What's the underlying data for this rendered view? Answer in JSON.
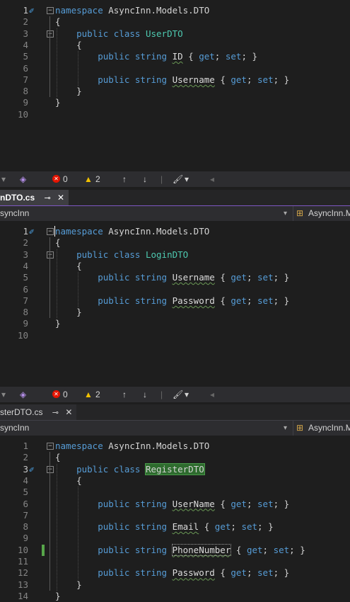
{
  "panes": [
    {
      "lines": [
        {
          "n": "1",
          "segs": [
            {
              "t": "namespace",
              "c": "kw"
            },
            {
              "t": " AsyncInn.Models.DTO",
              "c": "pl"
            }
          ]
        },
        {
          "n": "2",
          "segs": [
            {
              "t": "{",
              "c": "pl"
            }
          ]
        },
        {
          "n": "3",
          "segs": [
            {
              "t": "    public",
              "c": "kw"
            },
            {
              "t": " ",
              "c": "pl"
            },
            {
              "t": "class",
              "c": "kw"
            },
            {
              "t": " ",
              "c": "pl"
            },
            {
              "t": "UserDTO",
              "c": "ty"
            }
          ]
        },
        {
          "n": "4",
          "segs": [
            {
              "t": "    {",
              "c": "pl"
            }
          ]
        },
        {
          "n": "5",
          "segs": [
            {
              "t": "        public",
              "c": "kw"
            },
            {
              "t": " ",
              "c": "pl"
            },
            {
              "t": "string",
              "c": "kw"
            },
            {
              "t": " ",
              "c": "pl"
            },
            {
              "t": "ID",
              "c": "pr squig"
            },
            {
              "t": " { ",
              "c": "pl"
            },
            {
              "t": "get",
              "c": "kw"
            },
            {
              "t": "; ",
              "c": "pl"
            },
            {
              "t": "set",
              "c": "kw"
            },
            {
              "t": "; }",
              "c": "pl"
            }
          ]
        },
        {
          "n": "6",
          "segs": []
        },
        {
          "n": "7",
          "segs": [
            {
              "t": "        public",
              "c": "kw"
            },
            {
              "t": " ",
              "c": "pl"
            },
            {
              "t": "string",
              "c": "kw"
            },
            {
              "t": " ",
              "c": "pl"
            },
            {
              "t": "Username",
              "c": "pr squig"
            },
            {
              "t": " { ",
              "c": "pl"
            },
            {
              "t": "get",
              "c": "kw"
            },
            {
              "t": "; ",
              "c": "pl"
            },
            {
              "t": "set",
              "c": "kw"
            },
            {
              "t": "; }",
              "c": "pl"
            }
          ]
        },
        {
          "n": "8",
          "segs": [
            {
              "t": "    }",
              "c": "pl"
            }
          ]
        },
        {
          "n": "9",
          "segs": [
            {
              "t": "}",
              "c": "pl"
            }
          ]
        },
        {
          "n": "10",
          "segs": []
        }
      ]
    },
    {
      "tab_label": "nDTO.cs",
      "nav_left": "syncInn",
      "nav_right": "AsyncInn.M",
      "lines": [
        {
          "n": "1",
          "segs": [
            {
              "t": "namespace",
              "c": "kw"
            },
            {
              "t": " AsyncInn.Models.DTO",
              "c": "pl"
            }
          ]
        },
        {
          "n": "2",
          "segs": [
            {
              "t": "{",
              "c": "pl"
            }
          ]
        },
        {
          "n": "3",
          "segs": [
            {
              "t": "    public",
              "c": "kw"
            },
            {
              "t": " ",
              "c": "pl"
            },
            {
              "t": "class",
              "c": "kw"
            },
            {
              "t": " ",
              "c": "pl"
            },
            {
              "t": "LoginDTO",
              "c": "ty"
            }
          ]
        },
        {
          "n": "4",
          "segs": [
            {
              "t": "    {",
              "c": "pl"
            }
          ]
        },
        {
          "n": "5",
          "segs": [
            {
              "t": "        public",
              "c": "kw"
            },
            {
              "t": " ",
              "c": "pl"
            },
            {
              "t": "string",
              "c": "kw"
            },
            {
              "t": " ",
              "c": "pl"
            },
            {
              "t": "Username",
              "c": "pr squig"
            },
            {
              "t": " { ",
              "c": "pl"
            },
            {
              "t": "get",
              "c": "kw"
            },
            {
              "t": "; ",
              "c": "pl"
            },
            {
              "t": "set",
              "c": "kw"
            },
            {
              "t": "; }",
              "c": "pl"
            }
          ]
        },
        {
          "n": "6",
          "segs": []
        },
        {
          "n": "7",
          "segs": [
            {
              "t": "        public",
              "c": "kw"
            },
            {
              "t": " ",
              "c": "pl"
            },
            {
              "t": "string",
              "c": "kw"
            },
            {
              "t": " ",
              "c": "pl"
            },
            {
              "t": "Password",
              "c": "pr squig"
            },
            {
              "t": " { ",
              "c": "pl"
            },
            {
              "t": "get",
              "c": "kw"
            },
            {
              "t": "; ",
              "c": "pl"
            },
            {
              "t": "set",
              "c": "kw"
            },
            {
              "t": "; }",
              "c": "pl"
            }
          ]
        },
        {
          "n": "8",
          "segs": [
            {
              "t": "    }",
              "c": "pl"
            }
          ]
        },
        {
          "n": "9",
          "segs": [
            {
              "t": "}",
              "c": "pl"
            }
          ]
        },
        {
          "n": "10",
          "segs": []
        }
      ]
    },
    {
      "tab_label": "sterDTO.cs",
      "nav_left": "syncInn",
      "nav_right": "AsyncInn.M",
      "lines": [
        {
          "n": "1",
          "segs": [
            {
              "t": "namespace",
              "c": "kw"
            },
            {
              "t": " AsyncInn.Models.DTO",
              "c": "pl"
            }
          ]
        },
        {
          "n": "2",
          "segs": [
            {
              "t": "{",
              "c": "pl"
            }
          ]
        },
        {
          "n": "3",
          "segs": [
            {
              "t": "    public",
              "c": "kw"
            },
            {
              "t": " ",
              "c": "pl"
            },
            {
              "t": "class",
              "c": "kw"
            },
            {
              "t": " ",
              "c": "pl"
            },
            {
              "t": "RegisterDTO",
              "c": "ty hl"
            }
          ]
        },
        {
          "n": "4",
          "segs": [
            {
              "t": "    {",
              "c": "pl"
            }
          ]
        },
        {
          "n": "5",
          "segs": []
        },
        {
          "n": "6",
          "segs": [
            {
              "t": "        public",
              "c": "kw"
            },
            {
              "t": " ",
              "c": "pl"
            },
            {
              "t": "string",
              "c": "kw"
            },
            {
              "t": " ",
              "c": "pl"
            },
            {
              "t": "UserName",
              "c": "pr squig"
            },
            {
              "t": " { ",
              "c": "pl"
            },
            {
              "t": "get",
              "c": "kw"
            },
            {
              "t": "; ",
              "c": "pl"
            },
            {
              "t": "set",
              "c": "kw"
            },
            {
              "t": "; }",
              "c": "pl"
            }
          ]
        },
        {
          "n": "7",
          "segs": []
        },
        {
          "n": "8",
          "segs": [
            {
              "t": "        public",
              "c": "kw"
            },
            {
              "t": " ",
              "c": "pl"
            },
            {
              "t": "string",
              "c": "kw"
            },
            {
              "t": " ",
              "c": "pl"
            },
            {
              "t": "Email",
              "c": "pr squig"
            },
            {
              "t": " { ",
              "c": "pl"
            },
            {
              "t": "get",
              "c": "kw"
            },
            {
              "t": "; ",
              "c": "pl"
            },
            {
              "t": "set",
              "c": "kw"
            },
            {
              "t": "; }",
              "c": "pl"
            }
          ]
        },
        {
          "n": "9",
          "segs": []
        },
        {
          "n": "10",
          "segs": [
            {
              "t": "        public",
              "c": "kw"
            },
            {
              "t": " ",
              "c": "pl"
            },
            {
              "t": "string",
              "c": "kw"
            },
            {
              "t": " ",
              "c": "pl"
            },
            {
              "t": "PhoneNumber",
              "c": "pr squig phone"
            },
            {
              "t": " { ",
              "c": "pl"
            },
            {
              "t": "get",
              "c": "kw"
            },
            {
              "t": "; ",
              "c": "pl"
            },
            {
              "t": "set",
              "c": "kw"
            },
            {
              "t": "; }",
              "c": "pl"
            }
          ]
        },
        {
          "n": "11",
          "segs": []
        },
        {
          "n": "12",
          "segs": [
            {
              "t": "        public",
              "c": "kw"
            },
            {
              "t": " ",
              "c": "pl"
            },
            {
              "t": "string",
              "c": "kw"
            },
            {
              "t": " ",
              "c": "pl"
            },
            {
              "t": "Password",
              "c": "pr squig"
            },
            {
              "t": " { ",
              "c": "pl"
            },
            {
              "t": "get",
              "c": "kw"
            },
            {
              "t": "; ",
              "c": "pl"
            },
            {
              "t": "set",
              "c": "kw"
            },
            {
              "t": "; }",
              "c": "pl"
            }
          ]
        },
        {
          "n": "13",
          "segs": [
            {
              "t": "    }",
              "c": "pl"
            }
          ]
        },
        {
          "n": "14",
          "segs": [
            {
              "t": "}",
              "c": "pl"
            }
          ]
        }
      ]
    }
  ],
  "status": {
    "errors": "0",
    "warnings": "2"
  },
  "icons": {
    "brush": "paintbrush-icon",
    "error": "error-icon",
    "warning": "warning-icon",
    "up": "arrow-up-icon",
    "down": "arrow-down-icon",
    "pin": "pin-icon",
    "close": "close-icon",
    "dropdown": "dropdown-arrow-icon",
    "class": "class-icon"
  },
  "colors": {
    "keyword": "#569cd6",
    "type": "#4ec9b0",
    "accent": "#7e57c2",
    "error": "#e51400",
    "warning": "#f0c000",
    "change": "#57a64a"
  }
}
